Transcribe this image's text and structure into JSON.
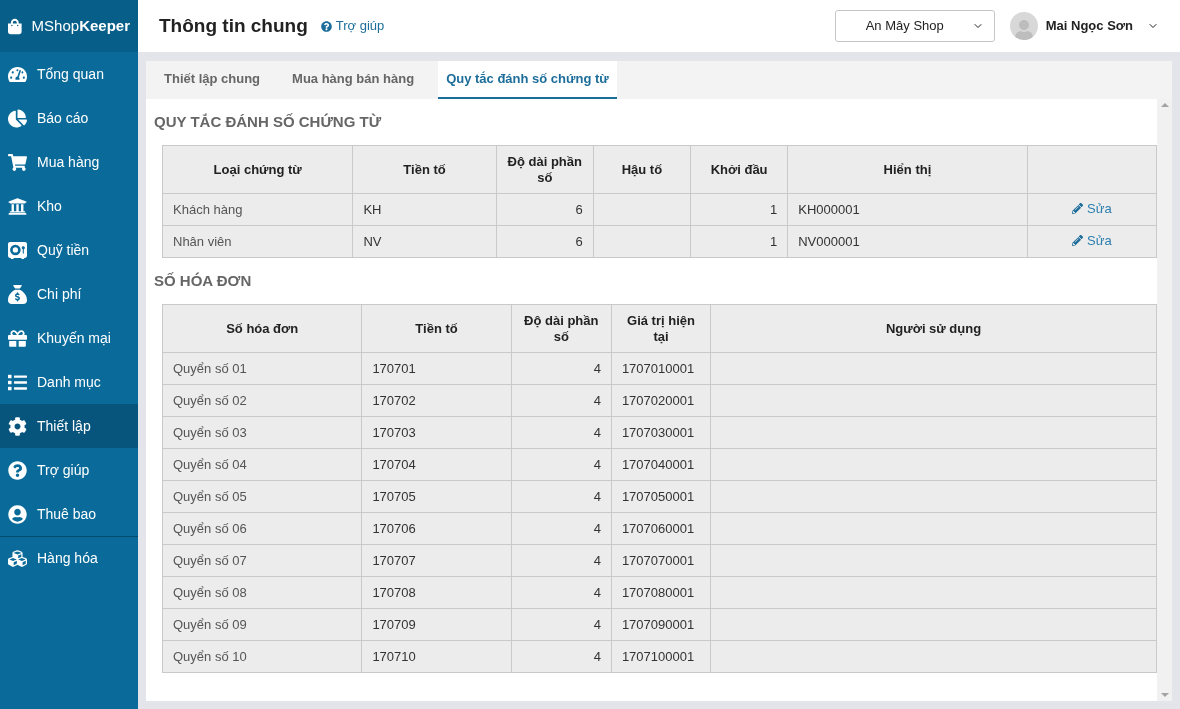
{
  "app": {
    "logo_light": "MShop",
    "logo_bold": "Keeper"
  },
  "sidebar": {
    "items": [
      {
        "label": "Tổng quan",
        "selected": false
      },
      {
        "label": "Báo cáo",
        "selected": false
      },
      {
        "label": "Mua hàng",
        "selected": false
      },
      {
        "label": "Kho",
        "selected": false
      },
      {
        "label": "Quỹ tiền",
        "selected": false
      },
      {
        "label": "Chi phí",
        "selected": false
      },
      {
        "label": "Khuyến mại",
        "selected": false
      },
      {
        "label": "Danh mục",
        "selected": false
      },
      {
        "label": "Thiết lập",
        "selected": true
      },
      {
        "label": "Trợ giúp",
        "selected": false
      },
      {
        "label": "Thuê bao",
        "selected": false
      },
      {
        "label": "Hàng hóa",
        "selected": false
      }
    ]
  },
  "header": {
    "title": "Thông tin chung",
    "help": "Trợ giúp",
    "shop": "An Mây Shop",
    "user": "Mai Ngọc Sơn"
  },
  "tabs": [
    {
      "label": "Thiết lập chung",
      "selected": false
    },
    {
      "label": "Mua hàng bán hàng",
      "selected": false
    },
    {
      "label": "Quy tắc đánh số chứng từ",
      "selected": true
    }
  ],
  "sections": [
    {
      "title": "QUY TẮC ĐÁNH SỐ CHỨNG TỪ",
      "columns": [
        {
          "label": "Loại chứng từ",
          "kind": "text"
        },
        {
          "label": "Tiền tố",
          "kind": "text"
        },
        {
          "label": "Độ dài phần số",
          "kind": "number"
        },
        {
          "label": "Hậu tố",
          "kind": "text"
        },
        {
          "label": "Khởi đầu",
          "kind": "number"
        },
        {
          "label": "Hiển thị",
          "kind": "text"
        },
        {
          "kind": "action"
        }
      ],
      "rows": [
        [
          "Khách hàng",
          "KH",
          "6",
          null,
          "1",
          "KH000001",
          "Sửa"
        ],
        [
          "Nhân viên",
          "NV",
          "6",
          null,
          "1",
          "NV000001",
          "Sửa"
        ]
      ]
    },
    {
      "title": "SỐ HÓA ĐƠN",
      "columns": [
        {
          "label": "Số hóa đơn",
          "kind": "text"
        },
        {
          "label": "Tiền tố",
          "kind": "text"
        },
        {
          "label": "Độ dài phần số",
          "kind": "number"
        },
        {
          "label": "Giá trị hiện tại",
          "kind": "text"
        },
        {
          "label": "Người sử dụng",
          "kind": "text"
        }
      ],
      "rows": [
        [
          "Quyển số 01",
          "170701",
          "4",
          "1707010001",
          null
        ],
        [
          "Quyển số 02",
          "170702",
          "4",
          "1707020001",
          null
        ],
        [
          "Quyển số 03",
          "170703",
          "4",
          "1707030001",
          null
        ],
        [
          "Quyển số 04",
          "170704",
          "4",
          "1707040001",
          null
        ],
        [
          "Quyển số 05",
          "170705",
          "4",
          "1707050001",
          null
        ],
        [
          "Quyển số 06",
          "170706",
          "4",
          "1707060001",
          null
        ],
        [
          "Quyển số 07",
          "170707",
          "4",
          "1707070001",
          null
        ],
        [
          "Quyển số 08",
          "170708",
          "4",
          "1707080001",
          null
        ],
        [
          "Quyển số 09",
          "170709",
          "4",
          "1707090001",
          null
        ],
        [
          "Quyển số 10",
          "170710",
          "4",
          "1707100001",
          null
        ]
      ]
    }
  ]
}
